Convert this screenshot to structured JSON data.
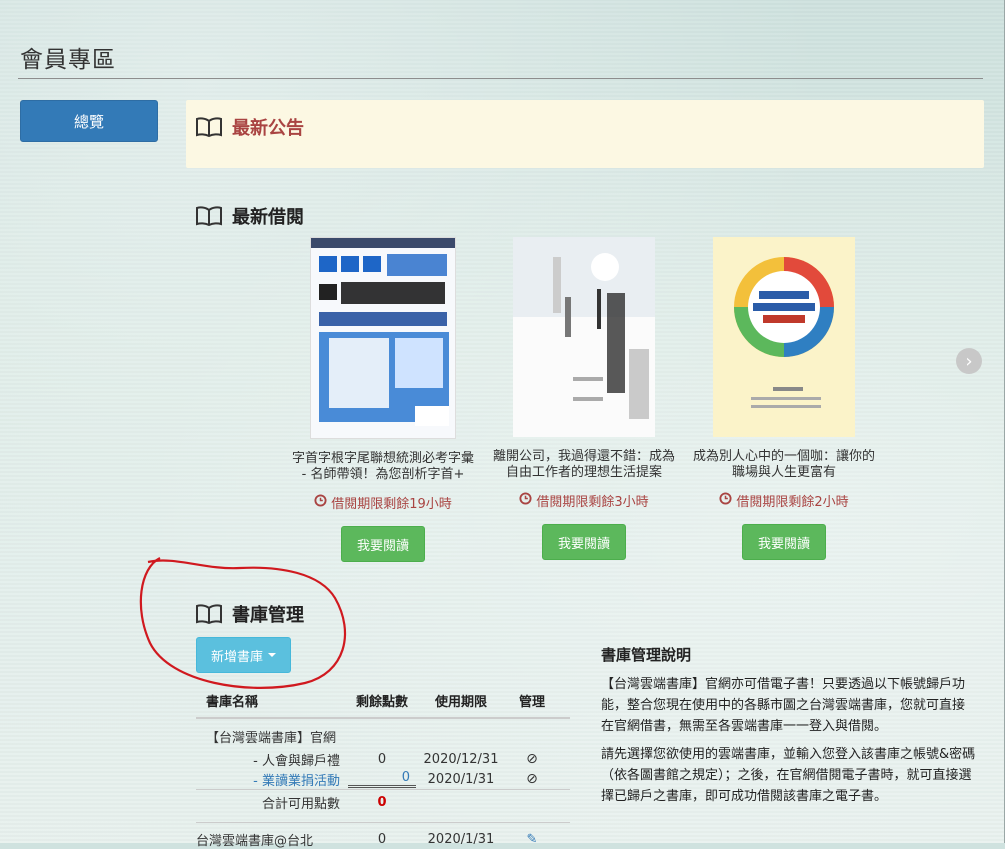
{
  "page": {
    "title": "會員專區"
  },
  "sidebar": {
    "overview_label": "總覽"
  },
  "announcements": {
    "heading": "最新公告",
    "icon": "book-icon"
  },
  "recent_borrows": {
    "heading": "最新借閱",
    "icon": "book-icon",
    "books": [
      {
        "title": "字首字根字尾聯想統測必考字彙 - 名師帶領！為您剖析字首+",
        "remaining": "借閱期限剩餘19小時",
        "button": "我要閱讀"
      },
      {
        "title": "離開公司，我過得還不錯：成為自由工作者的理想生活提案",
        "remaining": "借閱期限剩餘3小時",
        "button": "我要閱讀"
      },
      {
        "title": "成為別人心中的一個咖：讓你的職場與人生更富有",
        "remaining": "借閱期限剩餘2小時",
        "button": "我要閱讀"
      }
    ],
    "next_icon": "chevron-right-icon"
  },
  "library": {
    "heading": "書庫管理",
    "add_button": "新增書庫",
    "columns": [
      "書庫名稱",
      "剩餘點數",
      "使用期限",
      "管理"
    ],
    "group_name": "【台灣雲端書庫】官網",
    "sub_rows": [
      {
        "name": "- 人會與歸戶禮",
        "points": "0",
        "expiry": "2020/12/31"
      },
      {
        "name": "- 業讀業捐活動",
        "points": "0",
        "expiry": "2020/1/31"
      }
    ],
    "total_label": "合計可用點數",
    "total_points": "0",
    "next_row": {
      "name": "台灣雲端書庫@台北",
      "points": "0",
      "expiry": "2020/1/31"
    }
  },
  "info": {
    "heading": "書庫管理說明",
    "p1": "【台灣雲端書庫】官網亦可借電子書！只要透過以下帳號歸戶功能，整合您現在使用中的各縣市圖之台灣雲端書庫，您就可直接在官網借書，無需至各雲端書庫一一登入與借閱。",
    "p2": "請先選擇您欲使用的雲端書庫，並輸入您登入該書庫之帳號&密碼（依各圖書館之規定）；之後，在官網借閱電子書時，就可直接選擇已歸戶之書庫，即可成功借閱該書庫之電子書。"
  },
  "colors": {
    "primary": "#337ab7",
    "success": "#5cb85c",
    "info": "#5bc0de",
    "danger": "#a94442",
    "annotation": "#d0191f"
  }
}
